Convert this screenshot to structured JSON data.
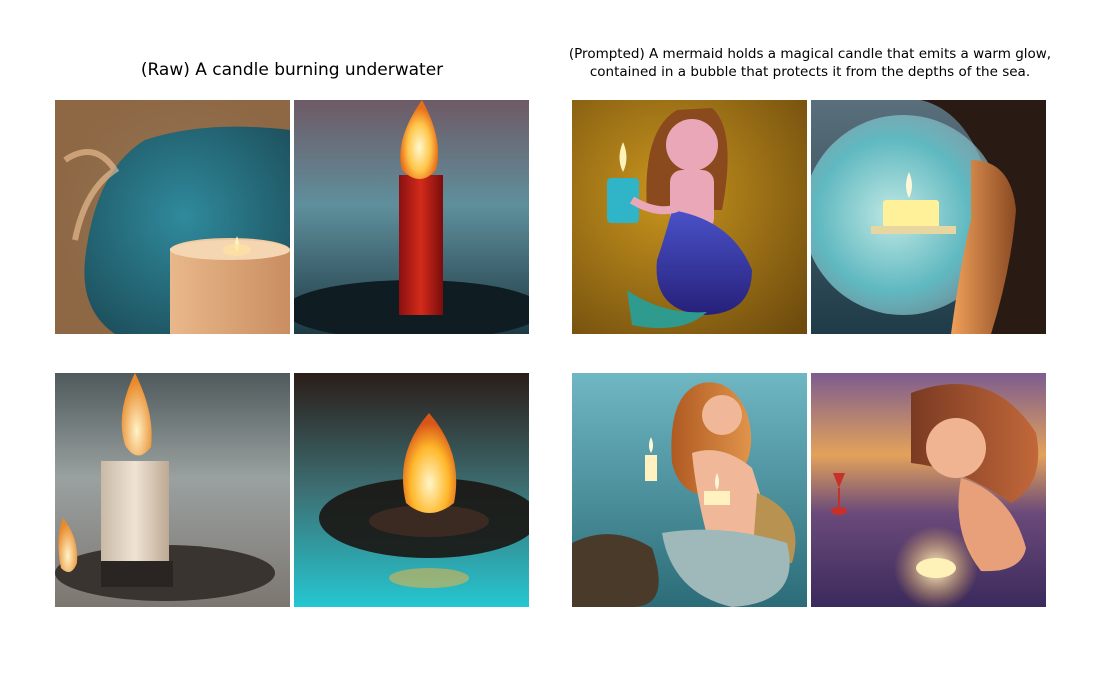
{
  "panels": [
    {
      "title": "(Raw) A candle burning underwater",
      "images": [
        {
          "subject": "white candle with small flame in swirling teal water"
        },
        {
          "subject": "red candle with tall flame above dark water"
        },
        {
          "subject": "white candle with flame on wet grey surface"
        },
        {
          "subject": "candle flame with ripples in teal water"
        }
      ]
    },
    {
      "title": "(Prompted) A mermaid holds a magical candle that emits a warm glow,\ncontained in a bubble that protects it from the depths of the sea.",
      "images": [
        {
          "subject": "illustrated mermaid holding blue candle on gold background"
        },
        {
          "subject": "woman holding candle inside a glass bubble"
        },
        {
          "subject": "mermaid holding candles in teal sea"
        },
        {
          "subject": "mermaid with floating candle at purple sunset"
        }
      ]
    }
  ]
}
